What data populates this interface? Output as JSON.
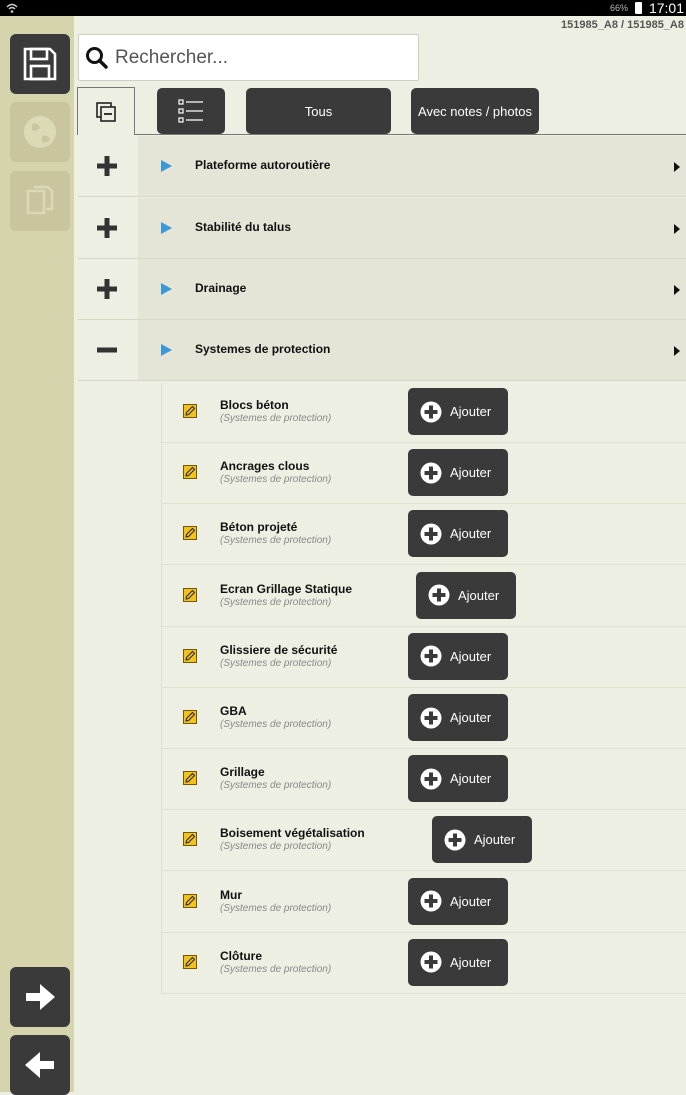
{
  "statusbar": {
    "battery": "66%",
    "time": "17:01"
  },
  "header": {
    "search_placeholder": "Rechercher...",
    "code": "151985_A8 / 151985_A8"
  },
  "toolbar": {
    "all_label": "Tous",
    "notes_label": "Avec notes / photos"
  },
  "categories": [
    {
      "label": "Plateforme autoroutière",
      "expanded": false
    },
    {
      "label": "Stabilité du talus",
      "expanded": false
    },
    {
      "label": "Drainage",
      "expanded": false
    },
    {
      "label": "Systemes de protection",
      "expanded": true
    }
  ],
  "items": [
    {
      "title": "Blocs béton",
      "subtitle": "(Systemes de protection)",
      "button": "Ajouter"
    },
    {
      "title": "Ancrages clous",
      "subtitle": "(Systemes de protection)",
      "button": "Ajouter"
    },
    {
      "title": "Béton projeté",
      "subtitle": "(Systemes de protection)",
      "button": "Ajouter"
    },
    {
      "title": "Ecran Grillage Statique",
      "subtitle": "(Systemes de protection)",
      "button": "Ajouter"
    },
    {
      "title": "Glissiere de sécurité",
      "subtitle": "(Systemes de protection)",
      "button": "Ajouter"
    },
    {
      "title": "GBA",
      "subtitle": "(Systemes de protection)",
      "button": "Ajouter"
    },
    {
      "title": "Grillage",
      "subtitle": "(Systemes de protection)",
      "button": "Ajouter"
    },
    {
      "title": "Boisement végétalisation",
      "subtitle": "(Systemes de protection)",
      "button": "Ajouter"
    },
    {
      "title": "Mur",
      "subtitle": "(Systemes de protection)",
      "button": "Ajouter"
    },
    {
      "title": "Clôture",
      "subtitle": "(Systemes de protection)",
      "button": "Ajouter"
    }
  ],
  "colors": {
    "background": "#eeefe3",
    "sidebar": "#d6d4ad",
    "button_dark": "#3a3a3a",
    "play_accent": "#3a9ad9",
    "note_icon": "#f2c21a"
  },
  "icons": {
    "sidebar": [
      "save-icon",
      "globe-icon",
      "copy-icon",
      "arrow-right-icon",
      "arrow-left-icon"
    ],
    "row_toggle_collapsed": "plus-icon",
    "row_toggle_expanded": "minus-icon",
    "row_marker": "play-icon",
    "row_chevron": "chevron-right-icon",
    "item": "edit-note-icon",
    "add": "plus-circle-icon"
  }
}
